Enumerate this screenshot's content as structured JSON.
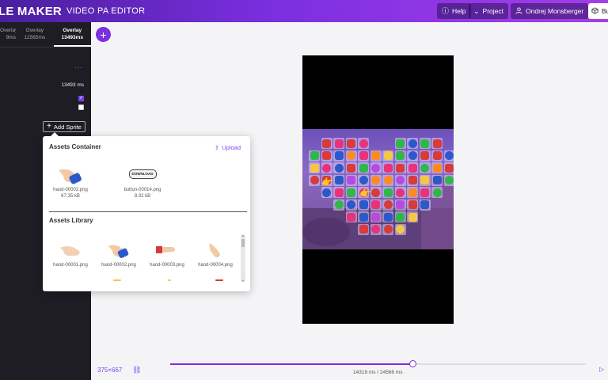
{
  "header": {
    "brand": "LE MAKER",
    "subtitle": "VIDEO PA EDITOR",
    "help_label": "Help",
    "project_label": "Project",
    "user_label": "Ondrej Monsberger",
    "build_label": "Bu",
    "colors": {
      "gradient_start": "#4a1f9e",
      "gradient_end": "#a43ee8"
    }
  },
  "sidebar": {
    "tabs": [
      {
        "label": "Overlay",
        "sub": "9ms"
      },
      {
        "label": "Overlay",
        "sub": "12565ms"
      },
      {
        "label": "Overlay",
        "sub": "13493ms",
        "active": true
      }
    ],
    "more_label": "...",
    "duration": "13493 ms",
    "add_sprite_label": "Add Sprite"
  },
  "popup": {
    "container_title": "Assets Container",
    "upload_label": "Upload",
    "container_assets": [
      {
        "name": "hand-00002.png",
        "size": "67.35 kB"
      },
      {
        "name": "button-00014.png",
        "size": "8.32 kB",
        "badge": "DOWNLOAD"
      }
    ],
    "library_title": "Assets Library",
    "library_assets": [
      {
        "name": "hand-00001.png"
      },
      {
        "name": "hand-00002.png"
      },
      {
        "name": "hand-00003.png"
      },
      {
        "name": "hand-00004.png"
      }
    ]
  },
  "footer": {
    "resolution": "375×667",
    "timecode": "14319 ms / 24566 ms",
    "progress": 0.5829
  },
  "icons": {
    "fab": "plus-icon",
    "help": "help-circle-icon",
    "project": "chevron-down-icon",
    "user": "user-icon",
    "build": "cube-icon",
    "upload": "upload-icon",
    "link": "link-icon",
    "play": "play-icon"
  }
}
